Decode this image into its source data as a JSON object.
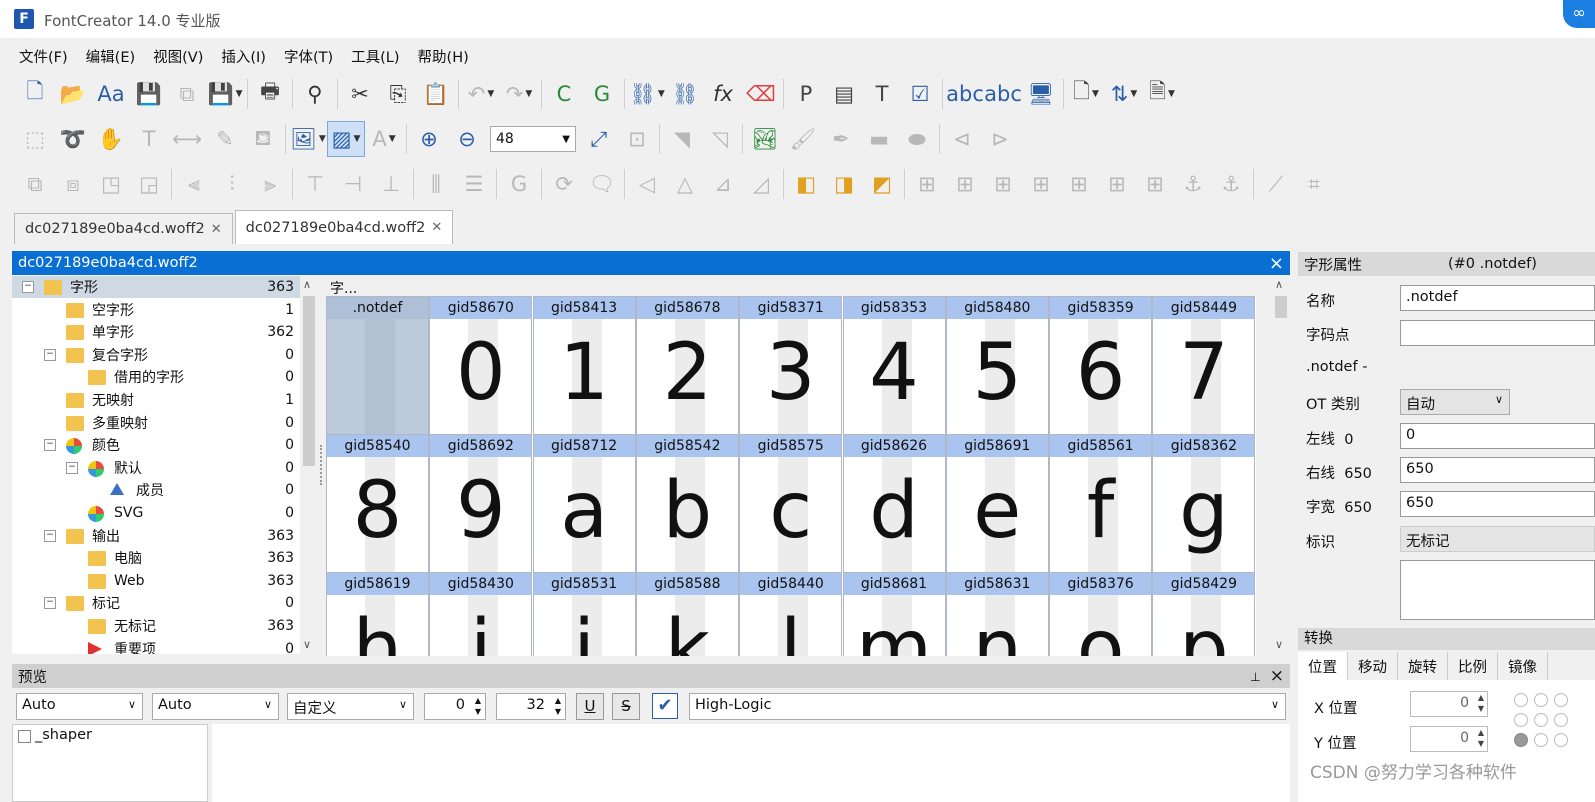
{
  "app": {
    "title": "FontCreator 14.0 专业版",
    "icon": "F"
  },
  "menu": [
    "文件(F)",
    "编辑(E)",
    "视图(V)",
    "插入(I)",
    "字体(T)",
    "工具(L)",
    "帮助(H)"
  ],
  "zoom": {
    "value": "48"
  },
  "tabs": [
    {
      "label": "dc027189e0ba4cd.woff2",
      "active": false
    },
    {
      "label": "dc027189e0ba4cd.woff2",
      "active": true
    }
  ],
  "panel": {
    "title": "dc027189e0ba4cd.woff2",
    "close": "×"
  },
  "tree": [
    {
      "label": "字形",
      "count": "363",
      "level": 0,
      "toggle": "−",
      "icon": "folder",
      "selected": true
    },
    {
      "label": "空字形",
      "count": "1",
      "level": 1,
      "toggle": "",
      "icon": "folder"
    },
    {
      "label": "单字形",
      "count": "362",
      "level": 1,
      "toggle": "",
      "icon": "folder"
    },
    {
      "label": "复合字形",
      "count": "0",
      "level": 1,
      "toggle": "−",
      "icon": "folder"
    },
    {
      "label": "借用的字形",
      "count": "0",
      "level": 2,
      "toggle": "",
      "icon": "folder"
    },
    {
      "label": "无映射",
      "count": "1",
      "level": 1,
      "toggle": "",
      "icon": "folder"
    },
    {
      "label": "多重映射",
      "count": "0",
      "level": 1,
      "toggle": "",
      "icon": "folder"
    },
    {
      "label": "颜色",
      "count": "0",
      "level": 1,
      "toggle": "−",
      "icon": "pie"
    },
    {
      "label": "默认",
      "count": "0",
      "level": 2,
      "toggle": "−",
      "icon": "pie"
    },
    {
      "label": "成员",
      "count": "0",
      "level": 3,
      "toggle": "",
      "icon": "tri"
    },
    {
      "label": "SVG",
      "count": "0",
      "level": 2,
      "toggle": "",
      "icon": "pie"
    },
    {
      "label": "输出",
      "count": "363",
      "level": 1,
      "toggle": "−",
      "icon": "folder"
    },
    {
      "label": "电脑",
      "count": "363",
      "level": 2,
      "toggle": "",
      "icon": "folder"
    },
    {
      "label": "Web",
      "count": "363",
      "level": 2,
      "toggle": "",
      "icon": "folder"
    },
    {
      "label": "标记",
      "count": "0",
      "level": 1,
      "toggle": "−",
      "icon": "folder"
    },
    {
      "label": "无标记",
      "count": "363",
      "level": 2,
      "toggle": "",
      "icon": "folder"
    },
    {
      "label": "重要项",
      "count": "0",
      "level": 2,
      "toggle": "",
      "icon": "flag"
    }
  ],
  "grid": {
    "label": "字...",
    "cells": [
      {
        "name": ".notdef",
        "char": ""
      },
      {
        "name": "gid58670",
        "char": "0"
      },
      {
        "name": "gid58413",
        "char": "1"
      },
      {
        "name": "gid58678",
        "char": "2"
      },
      {
        "name": "gid58371",
        "char": "3"
      },
      {
        "name": "gid58353",
        "char": "4"
      },
      {
        "name": "gid58480",
        "char": "5"
      },
      {
        "name": "gid58359",
        "char": "6"
      },
      {
        "name": "gid58449",
        "char": "7"
      },
      {
        "name": "gid58540",
        "char": "8"
      },
      {
        "name": "gid58692",
        "char": "9"
      },
      {
        "name": "gid58712",
        "char": "a"
      },
      {
        "name": "gid58542",
        "char": "b"
      },
      {
        "name": "gid58575",
        "char": "c"
      },
      {
        "name": "gid58626",
        "char": "d"
      },
      {
        "name": "gid58691",
        "char": "e"
      },
      {
        "name": "gid58561",
        "char": "f"
      },
      {
        "name": "gid58362",
        "char": "g"
      },
      {
        "name": "gid58619",
        "char": "h"
      },
      {
        "name": "gid58430",
        "char": "i"
      },
      {
        "name": "gid58531",
        "char": "j"
      },
      {
        "name": "gid58588",
        "char": "k"
      },
      {
        "name": "gid58440",
        "char": "l"
      },
      {
        "name": "gid58681",
        "char": "m"
      },
      {
        "name": "gid58631",
        "char": "n"
      },
      {
        "name": "gid58376",
        "char": "o"
      },
      {
        "name": "gid58429",
        "char": "p"
      }
    ]
  },
  "props": {
    "title": "字形属性",
    "glyph": "(#0 .notdef)",
    "name_label": "名称",
    "name_value": ".notdef",
    "codepoint_label": "字码点",
    "codepoint_value": "",
    "notdef_line": ".notdef -",
    "ot_label": "OT 类别",
    "ot_value": "自动",
    "lsb_label": "左线",
    "lsb_num": "0",
    "lsb_value": "0",
    "rsb_label": "右线",
    "rsb_num": "650",
    "rsb_value": "650",
    "adv_label": "字宽",
    "adv_num": "650",
    "adv_value": "650",
    "mark_label": "标识",
    "mark_value": "无标记"
  },
  "transform": {
    "title": "转换",
    "tabs": [
      "位置",
      "移动",
      "旋转",
      "比例",
      "镜像"
    ],
    "x_label": "X 位置",
    "x_value": "0",
    "y_label": "Y 位置",
    "y_value": "0"
  },
  "preview": {
    "title": "预览",
    "pin": "📌",
    "close": "×",
    "select1": "Auto",
    "select2": "Auto",
    "select3": "自定义",
    "spin1": "0",
    "spin2": "32",
    "underline": "U",
    "strike": "S",
    "text": "High-Logic",
    "shaper": "_shaper"
  },
  "watermark": "CSDN @努力学习各种软件"
}
